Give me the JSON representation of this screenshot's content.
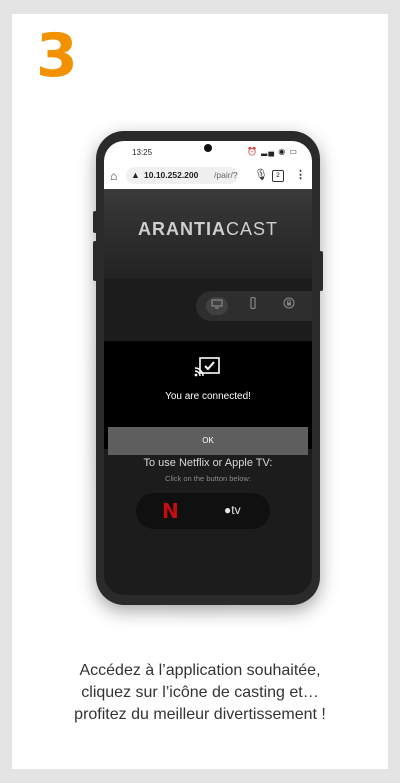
{
  "step_number": "3",
  "phone": {
    "status_time": "13:25",
    "url_host": "10.10.252.200",
    "url_path": "/pair/?",
    "tab_count": "2",
    "app_logo_bold": "ARANTIA",
    "app_logo_light": "CAST",
    "modal_message": "You are connected!",
    "ok_button": "OK",
    "netflix_title": "To use Netflix or Apple TV:",
    "netflix_subtitle": "Click on the button below:",
    "netflix_logo": "N",
    "appletv_label": "tv"
  },
  "caption": {
    "line1": "Accédez à l’application souhaitée,",
    "line2": "cliquez sur l’icône de casting et…",
    "line3": "profitez du meilleur divertissement !"
  },
  "colors": {
    "accent": "#f39200",
    "netflix_red": "#c50d12"
  },
  "icons": [
    "home-icon",
    "warning-icon",
    "mic-icon",
    "tabs-icon",
    "menu-icon",
    "tv-icon",
    "remote-icon",
    "lock-icon",
    "cast-icon",
    "apple-icon"
  ]
}
